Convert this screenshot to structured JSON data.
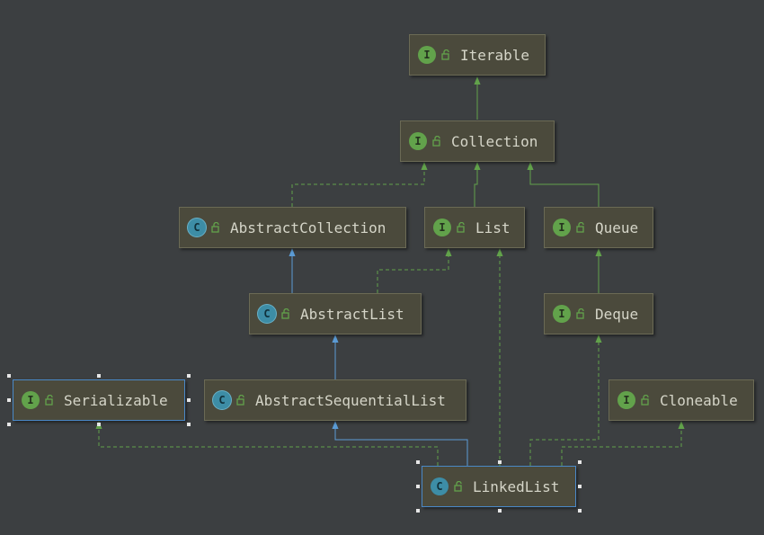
{
  "diagram": {
    "nodes": [
      {
        "id": "iterable",
        "label": "Iterable",
        "kind": "interface",
        "kind_letter": "I"
      },
      {
        "id": "collection",
        "label": "Collection",
        "kind": "interface",
        "kind_letter": "I"
      },
      {
        "id": "abstractcollection",
        "label": "AbstractCollection",
        "kind": "abstract-class",
        "kind_letter": "C"
      },
      {
        "id": "list",
        "label": "List",
        "kind": "interface",
        "kind_letter": "I"
      },
      {
        "id": "queue",
        "label": "Queue",
        "kind": "interface",
        "kind_letter": "I"
      },
      {
        "id": "abstractlist",
        "label": "AbstractList",
        "kind": "abstract-class",
        "kind_letter": "C"
      },
      {
        "id": "deque",
        "label": "Deque",
        "kind": "interface",
        "kind_letter": "I"
      },
      {
        "id": "serializable",
        "label": "Serializable",
        "kind": "interface",
        "kind_letter": "I",
        "selected": true
      },
      {
        "id": "abstractsequentiallist",
        "label": "AbstractSequentialList",
        "kind": "abstract-class",
        "kind_letter": "C"
      },
      {
        "id": "cloneable",
        "label": "Cloneable",
        "kind": "interface",
        "kind_letter": "I"
      },
      {
        "id": "linkedlist",
        "label": "LinkedList",
        "kind": "class",
        "kind_letter": "C",
        "selected": true
      }
    ],
    "edges": [
      {
        "from": "collection",
        "to": "iterable",
        "relation": "extends"
      },
      {
        "from": "abstractcollection",
        "to": "collection",
        "relation": "implements"
      },
      {
        "from": "list",
        "to": "collection",
        "relation": "extends"
      },
      {
        "from": "queue",
        "to": "collection",
        "relation": "extends"
      },
      {
        "from": "abstractlist",
        "to": "abstractcollection",
        "relation": "extends"
      },
      {
        "from": "abstractlist",
        "to": "list",
        "relation": "implements"
      },
      {
        "from": "deque",
        "to": "queue",
        "relation": "extends"
      },
      {
        "from": "abstractsequentiallist",
        "to": "abstractlist",
        "relation": "extends"
      },
      {
        "from": "linkedlist",
        "to": "abstractsequentiallist",
        "relation": "extends"
      },
      {
        "from": "linkedlist",
        "to": "list",
        "relation": "implements"
      },
      {
        "from": "linkedlist",
        "to": "deque",
        "relation": "implements"
      },
      {
        "from": "linkedlist",
        "to": "cloneable",
        "relation": "implements"
      },
      {
        "from": "linkedlist",
        "to": "serializable",
        "relation": "implements"
      }
    ],
    "colors": {
      "background": "#3c3f41",
      "node_fill": "#4b4a3c",
      "interface_badge": "#62a24b",
      "class_badge": "#3d8da6",
      "extends_interface_edge": "#62a24b",
      "extends_class_edge": "#5b9bd5",
      "implements_edge": "#62a24b",
      "selection": "#4a88c7"
    },
    "icons": {
      "interface": "interface-icon",
      "class": "class-icon",
      "abstract-class": "abstract-class-icon",
      "visibility": "public-visibility-icon"
    }
  }
}
